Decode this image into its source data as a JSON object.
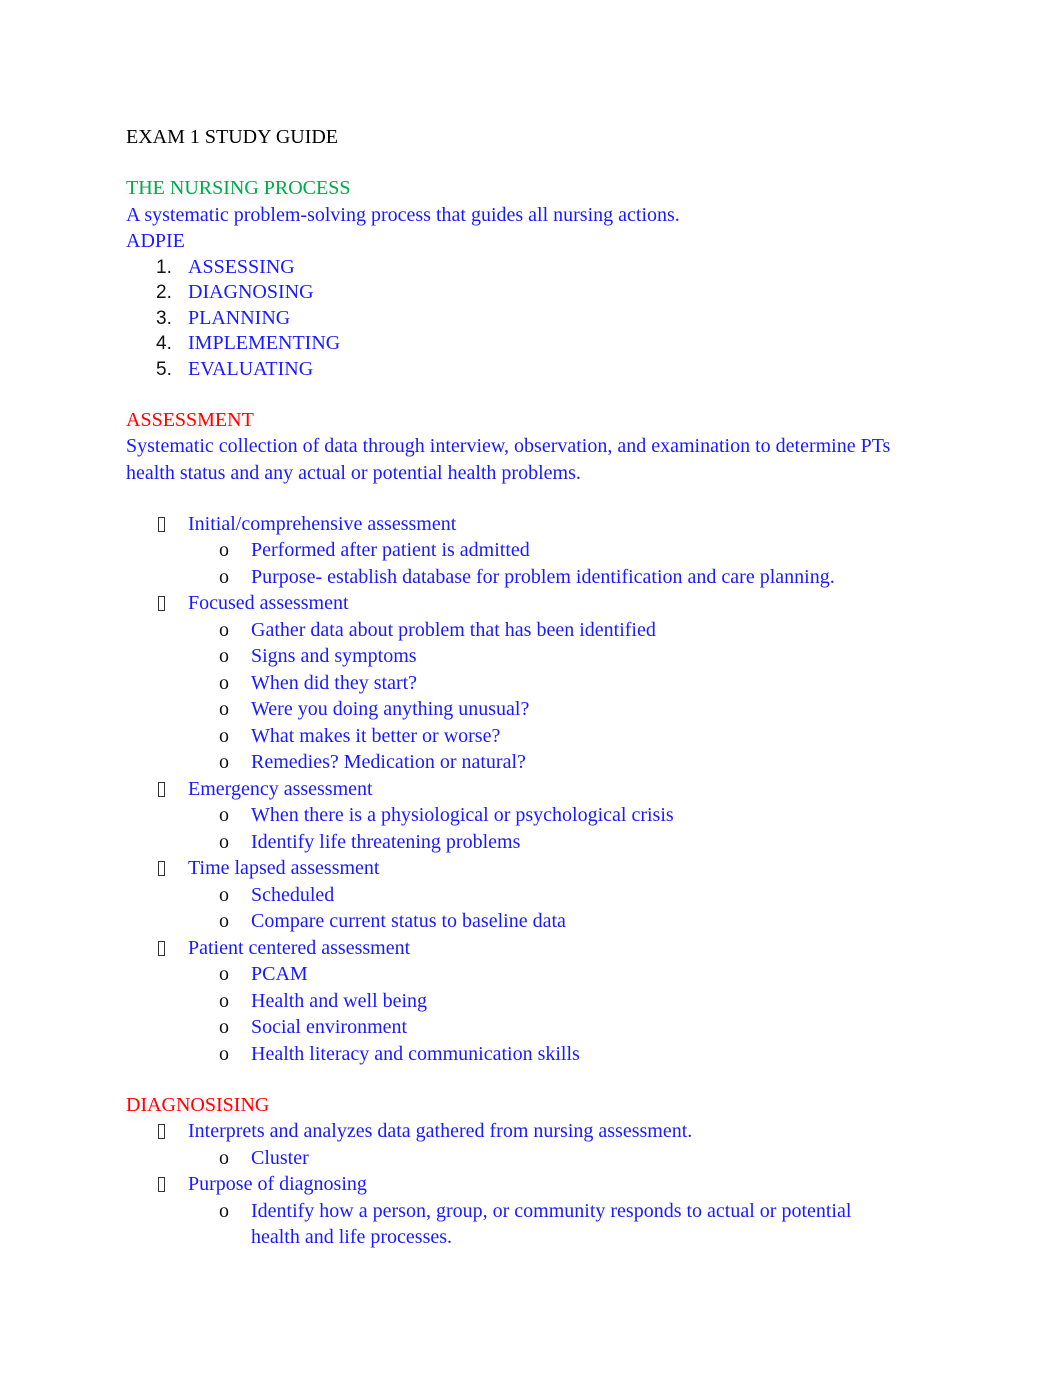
{
  "title": "EXAM 1 STUDY GUIDE",
  "colors": {
    "heading_green": "#00a850",
    "heading_red": "#ff0000",
    "body_blue": "#1a1aff"
  },
  "nursing_process": {
    "heading": "THE NURSING PROCESS",
    "definition": "A systematic problem-solving process that guides all nursing actions.",
    "acronym": "ADPIE",
    "steps": [
      {
        "num": "1.",
        "label": "ASSESSING"
      },
      {
        "num": "2.",
        "label": "DIAGNOSING"
      },
      {
        "num": "3.",
        "label": "PLANNING"
      },
      {
        "num": "4.",
        "label": "IMPLEMENTING"
      },
      {
        "num": "5.",
        "label": "EVALUATING"
      }
    ]
  },
  "assessment": {
    "heading": "ASSESSMENT",
    "definition_line1": "Systematic collection of data through interview, observation, and examination to determine PTs",
    "definition_line2": "health status and any actual or potential health problems.",
    "bullet_glyph": "o",
    "items": [
      {
        "label": "Initial/comprehensive assessment",
        "sub": [
          "Performed after patient is admitted",
          "Purpose- establish database for problem identification and care planning."
        ]
      },
      {
        "label": "Focused assessment",
        "sub": [
          "Gather data about problem that has been identified",
          "Signs and symptoms",
          "When did they start?",
          "Were you doing anything unusual?",
          "What makes it better or worse?",
          "Remedies? Medication or natural?"
        ]
      },
      {
        "label": "Emergency assessment",
        "sub": [
          "When there is a physiological or psychological crisis",
          "Identify life threatening problems"
        ]
      },
      {
        "label": "Time lapsed assessment",
        "sub": [
          "Scheduled",
          "Compare current status to baseline data"
        ]
      },
      {
        "label": "Patient centered assessment",
        "sub": [
          "PCAM",
          "Health and well being",
          "Social environment",
          "Health literacy and communication skills"
        ]
      }
    ]
  },
  "diagnosing": {
    "heading": "DIAGNOSISING",
    "items": [
      {
        "label": "Interprets and analyzes data gathered from nursing assessment.",
        "sub": [
          "Cluster"
        ]
      },
      {
        "label": "Purpose of diagnosing",
        "sub": [
          "Identify how a person, group, or community responds to actual or potential health and life processes."
        ]
      }
    ]
  }
}
